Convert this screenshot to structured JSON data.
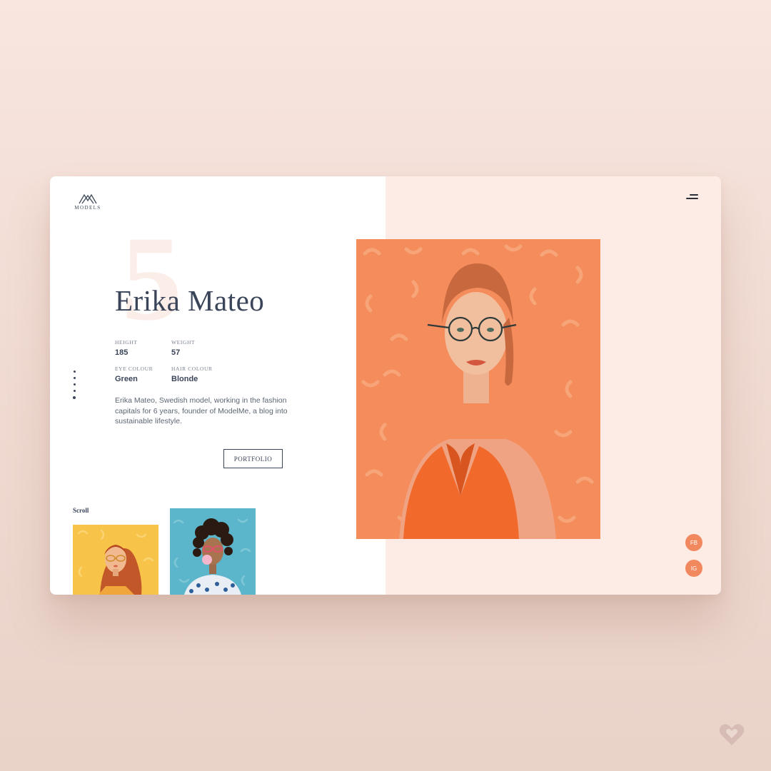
{
  "brand": {
    "name": "MODELS"
  },
  "model": {
    "number": "5",
    "name": "Erika Mateo",
    "stats": [
      {
        "label": "HEIGHT",
        "value": "185"
      },
      {
        "label": "WEIGHT",
        "value": "57"
      },
      {
        "label": "EYE COLOUR",
        "value": "Green"
      },
      {
        "label": "HAIR COLOUR",
        "value": "Blonde"
      }
    ],
    "bio": "Erika Mateo, Swedish model, working in the fashion capitals for 6 years, founder of ModelMe, a blog into sustainable lifestyle.",
    "cta": "PORTFOLIO"
  },
  "scroll": {
    "label": "Scroll"
  },
  "social": {
    "fb": "FB",
    "ig": "IG"
  },
  "colors": {
    "accent": "#f1885e",
    "text": "#3b4559",
    "panel": "#fdece6",
    "hero_bg": "#f48c5c",
    "dress": "#f26a2b",
    "thumb_yellow": "#f7c349",
    "thumb_blue": "#5cb6cb"
  },
  "icons": [
    "logo-mountain-icon",
    "menu-icon",
    "heart-icon"
  ]
}
